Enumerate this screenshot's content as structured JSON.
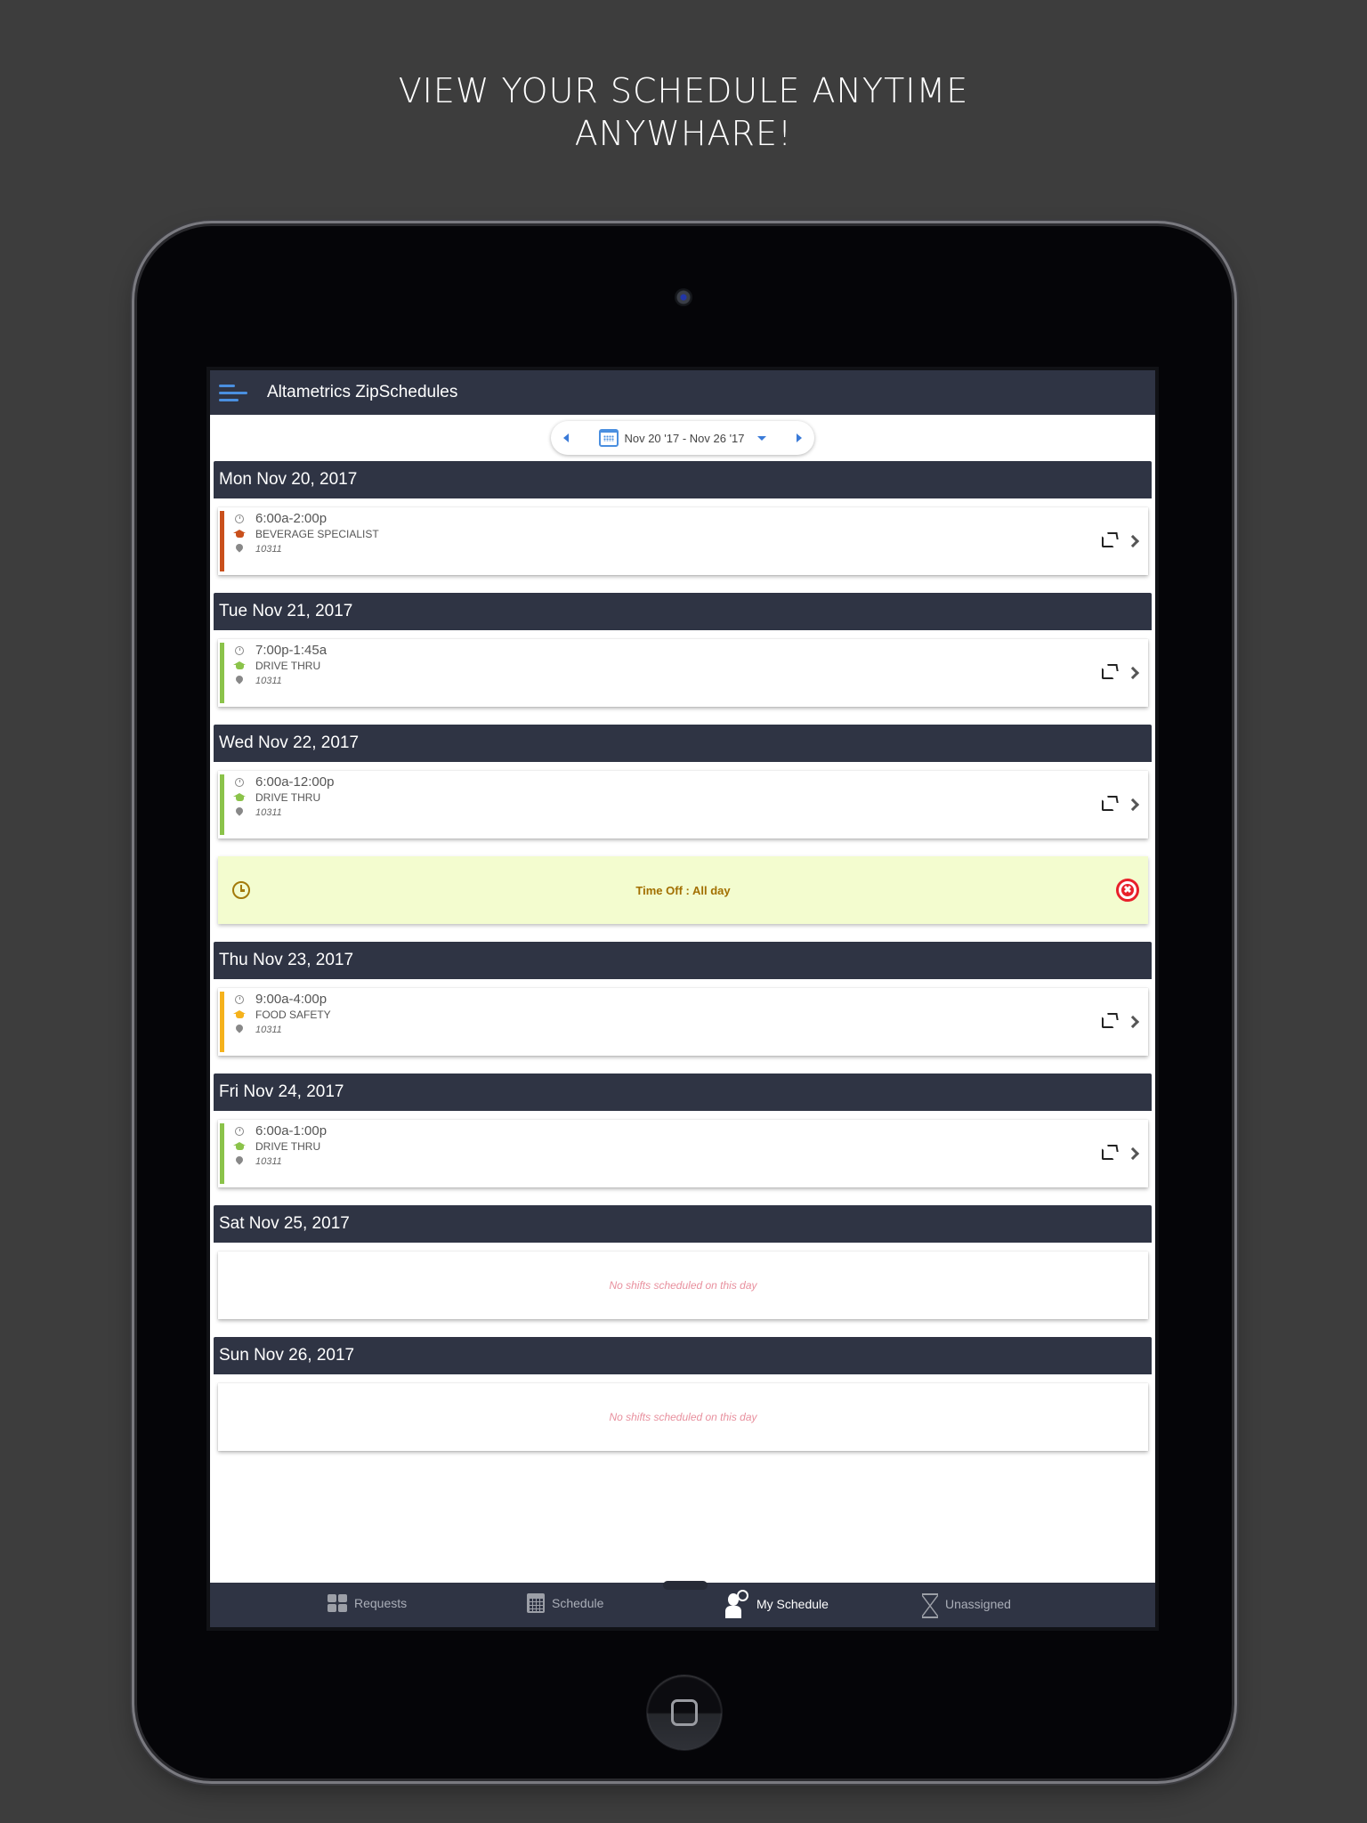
{
  "promo": {
    "headline_line1": "VIEW YOUR SCHEDULE ANYTIME",
    "headline_line2": "ANYWHARE!"
  },
  "app": {
    "title": "Altametrics ZipSchedules",
    "menu_icon": "hamburger-menu-icon"
  },
  "week_nav": {
    "range_label": "Nov 20 '17 - Nov 26 '17",
    "prev_icon": "caret-left-icon",
    "next_icon": "caret-right-icon",
    "calendar_icon": "calendar-icon",
    "dropdown_icon": "caret-down-icon"
  },
  "colors": {
    "header_bg": "#2f3444",
    "accent_blue": "#4a8fe0",
    "orange": "#c9501c",
    "green": "#8bc34a",
    "yellow": "#f5b21c",
    "timeoff_bg": "#f3fccf",
    "timeoff_text": "#a26f00",
    "cancel_red": "#e8202a",
    "empty_text": "#e8909e"
  },
  "days": [
    {
      "header": "Mon Nov 20, 2017",
      "shifts": [
        {
          "time": "6:00a-2:00p",
          "role": "BEVERAGE SPECIALIST",
          "location": "10311",
          "color": "#c9501c"
        }
      ]
    },
    {
      "header": "Tue Nov 21, 2017",
      "shifts": [
        {
          "time": "7:00p-1:45a",
          "role": "DRIVE THRU",
          "location": "10311",
          "color": "#8bc34a"
        }
      ]
    },
    {
      "header": "Wed Nov 22, 2017",
      "shifts": [
        {
          "time": "6:00a-12:00p",
          "role": "DRIVE THRU",
          "location": "10311",
          "color": "#8bc34a"
        }
      ],
      "time_off": "Time Off : All day"
    },
    {
      "header": "Thu Nov 23, 2017",
      "shifts": [
        {
          "time": "9:00a-4:00p",
          "role": "FOOD SAFETY",
          "location": "10311",
          "color": "#f5b21c"
        }
      ]
    },
    {
      "header": "Fri Nov 24, 2017",
      "shifts": [
        {
          "time": "6:00a-1:00p",
          "role": "DRIVE THRU",
          "location": "10311",
          "color": "#8bc34a"
        }
      ]
    },
    {
      "header": "Sat Nov 25, 2017",
      "shifts": [],
      "empty_message": "No shifts scheduled on this day"
    },
    {
      "header": "Sun Nov 26, 2017",
      "shifts": [],
      "empty_message": "No shifts scheduled on this day"
    }
  ],
  "tabs": [
    {
      "label": "Requests",
      "icon": "grid-icon",
      "active": false
    },
    {
      "label": "Schedule",
      "icon": "calendar-icon",
      "active": false
    },
    {
      "label": "My Schedule",
      "icon": "person-clock-icon",
      "active": true
    },
    {
      "label": "Unassigned",
      "icon": "hourglass-icon",
      "active": false
    }
  ]
}
